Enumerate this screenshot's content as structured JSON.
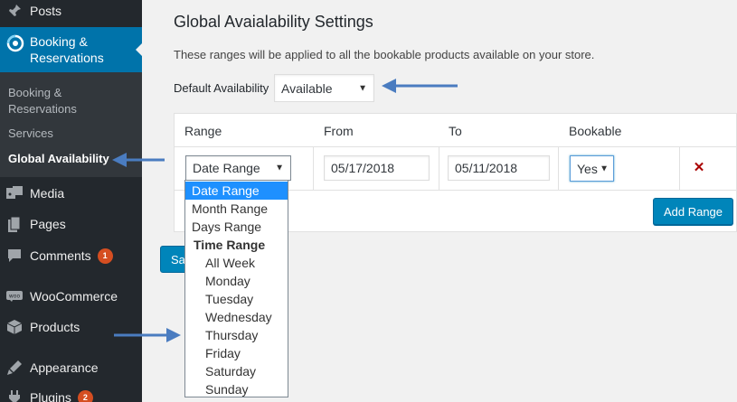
{
  "sidebar": {
    "items": [
      {
        "label": "Posts",
        "icon": "pin-icon"
      },
      {
        "label": "Booking & Reservations",
        "icon": "booking-icon"
      },
      {
        "label": "Media",
        "icon": "media-icon"
      },
      {
        "label": "Pages",
        "icon": "pages-icon"
      },
      {
        "label": "Comments",
        "icon": "comments-icon",
        "badge": "1"
      },
      {
        "label": "WooCommerce",
        "icon": "woocommerce-icon"
      },
      {
        "label": "Products",
        "icon": "products-icon"
      },
      {
        "label": "Appearance",
        "icon": "appearance-icon"
      },
      {
        "label": "Plugins",
        "icon": "plugins-icon",
        "badge": "2"
      }
    ],
    "booking_label_line1": "Booking &",
    "booking_label_line2": "Reservations",
    "submenu": {
      "booking_line1": "Booking &",
      "booking_line2": "Reservations",
      "services": "Services",
      "global_availability": "Global Availability"
    }
  },
  "main": {
    "title": "Global Avaialability Settings",
    "description": "These ranges will be applied to all the bookable products available on your store.",
    "default_availability_label": "Default Availability",
    "default_availability_value": "Available",
    "table": {
      "headers": {
        "range": "Range",
        "from": "From",
        "to": "To",
        "bookable": "Bookable"
      },
      "row": {
        "range": "Date Range",
        "from": "05/17/2018",
        "to": "05/11/2018",
        "bookable": "Yes",
        "remove": "✕"
      },
      "add_range_label": "Add Range"
    },
    "save_label": "Save"
  },
  "dropdown": {
    "options": [
      {
        "label": "Date Range",
        "selected": true
      },
      {
        "label": "Month Range"
      },
      {
        "label": "Days Range"
      }
    ],
    "group_label": "Time Range",
    "group_options": [
      "All Week",
      "Monday",
      "Tuesday",
      "Wednesday",
      "Thursday",
      "Friday",
      "Saturday",
      "Sunday"
    ]
  },
  "colors": {
    "sidebar_bg": "#23282d",
    "active_bg": "#0073aa",
    "primary_button": "#0085ba",
    "arrow": "#4a7cc0",
    "badge": "#d54e21",
    "remove": "#aa0000"
  }
}
